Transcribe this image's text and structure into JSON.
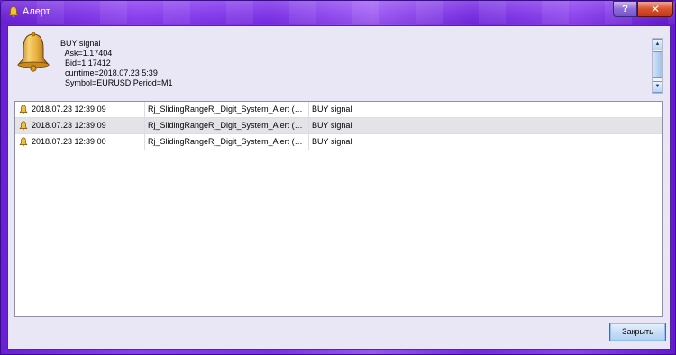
{
  "window": {
    "title": "Алерт",
    "help_label": "?",
    "close_label": "✕"
  },
  "message": {
    "text": "BUY signal\n  Ask=1.17404\n  Bid=1.17412\n  currtime=2018.07.23 5:39\n  Symbol=EURUSD Period=M1"
  },
  "alerts": [
    {
      "time": "2018.07.23 12:39:09",
      "source": "Rj_SlidingRangeRj_Digit_System_Alert (…",
      "text": "BUY signal"
    },
    {
      "time": "2018.07.23 12:39:09",
      "source": "Rj_SlidingRangeRj_Digit_System_Alert (…",
      "text": "BUY signal"
    },
    {
      "time": "2018.07.23 12:39:00",
      "source": "Rj_SlidingRangeRj_Digit_System_Alert (…",
      "text": "BUY signal"
    }
  ],
  "buttons": {
    "close": "Закрыть"
  },
  "icons": {
    "window": "bell-icon",
    "message": "bell-icon",
    "row": "bell-icon"
  },
  "colors": {
    "frame": "#7a2ee6",
    "selected_row": "#e4e4e8"
  }
}
